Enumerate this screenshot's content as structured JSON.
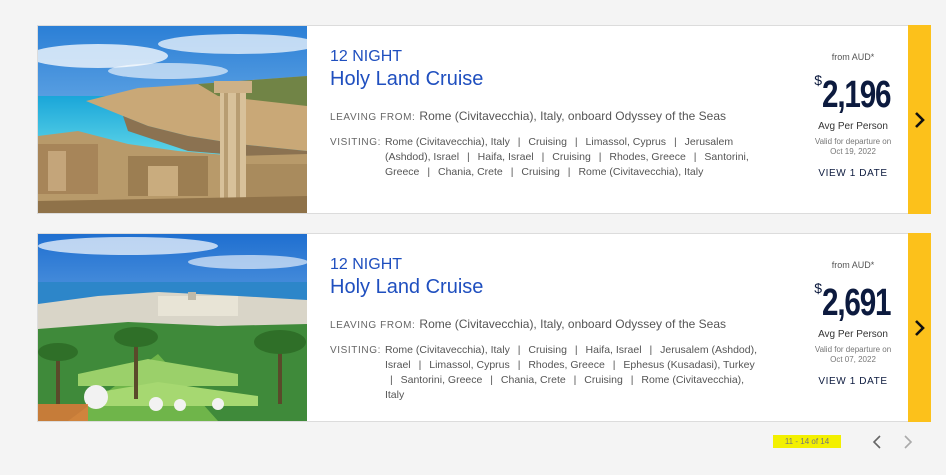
{
  "cruises": [
    {
      "nights": "12 NIGHT",
      "title": "Holy Land Cruise",
      "leaving_label": "LEAVING FROM:",
      "leaving_value": "Rome (Civitavecchia), Italy, onboard Odyssey of the Seas",
      "visiting_label": "VISITING:",
      "ports": [
        "Rome (Civitavecchia), Italy",
        "Cruising",
        "Limassol, Cyprus",
        "Jerusalem (Ashdod), Israel",
        "Haifa, Israel",
        "Cruising",
        "Rhodes, Greece",
        "Santorini, Greece",
        "Chania, Crete",
        "Cruising",
        "Rome (Civitavecchia), Italy"
      ],
      "from_label": "from AUD*",
      "currency": "$",
      "price": "2,196",
      "avg_label": "Avg Per Person",
      "valid_line1": "Valid for departure on",
      "valid_line2": "Oct 19, 2022",
      "view_label": "VIEW 1 DATE",
      "image": "cyprus-coast-ruins-photo"
    },
    {
      "nights": "12 NIGHT",
      "title": "Holy Land Cruise",
      "leaving_label": "LEAVING FROM:",
      "leaving_value": "Rome (Civitavecchia), Italy, onboard Odyssey of the Seas",
      "visiting_label": "VISITING:",
      "ports": [
        "Rome (Civitavecchia), Italy",
        "Cruising",
        "Haifa, Israel",
        "Jerusalem (Ashdod), Israel",
        "Limassol, Cyprus",
        "Rhodes, Greece",
        "Ephesus (Kusadasi), Turkey",
        "Santorini, Greece",
        "Chania, Crete",
        "Cruising",
        "Rome (Civitavecchia), Italy"
      ],
      "from_label": "from AUD*",
      "currency": "$",
      "price": "2,691",
      "avg_label": "Avg Per Person",
      "valid_line1": "Valid for departure on",
      "valid_line2": "Oct 07, 2022",
      "view_label": "VIEW 1 DATE",
      "image": "haifa-gardens-photo"
    }
  ],
  "pagination": {
    "count_text": "11 - 14 of 14",
    "prev_icon": "chevron-left-icon",
    "next_icon": "chevron-right-icon"
  },
  "colors": {
    "accent": "#fcc11b",
    "title_blue": "#1f4fbf",
    "price_navy": "#0c1a3e",
    "highlight": "#f3f000"
  }
}
